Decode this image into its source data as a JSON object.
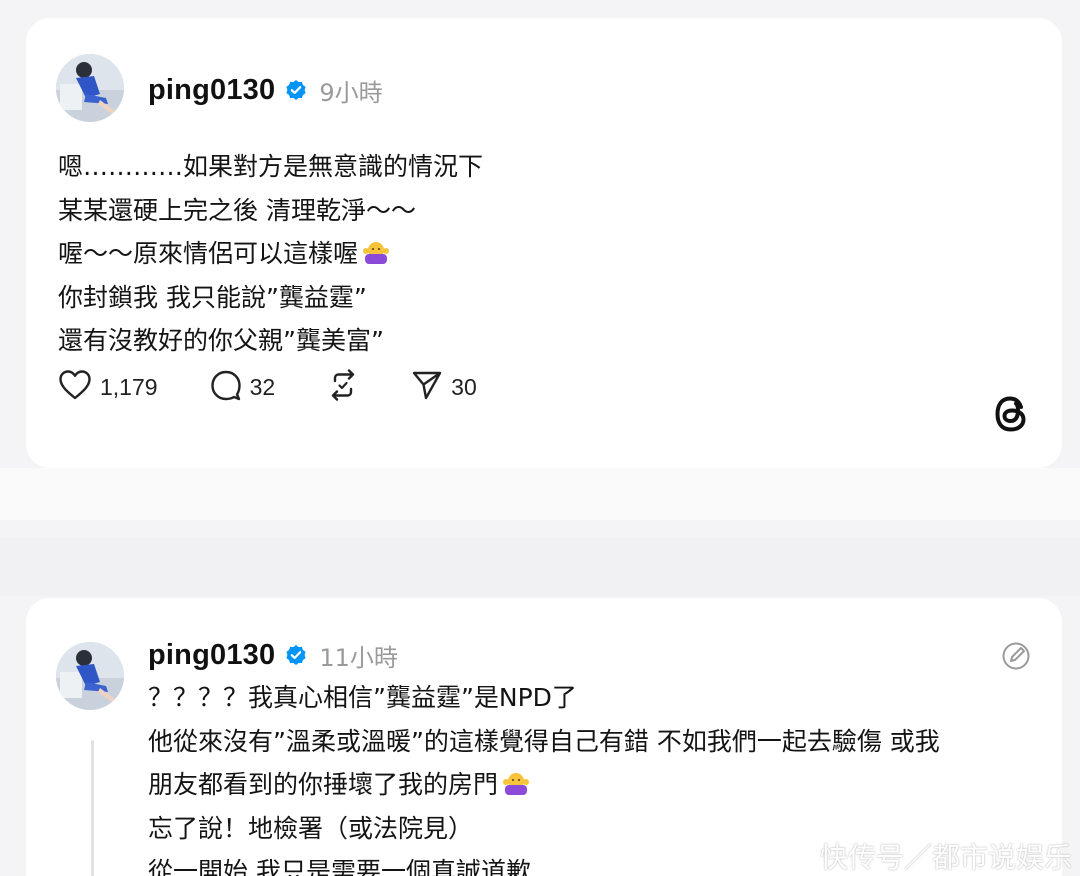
{
  "posts": [
    {
      "username": "ping0130",
      "time": "9小時",
      "lines": [
        "嗯…………如果對方是無意識的情況下",
        "某某還硬上完之後 清理乾淨～～",
        "喔～～原來情侶可以這樣喔",
        "你封鎖我 我只能說”龔益霆”",
        "還有沒教好的你父親”龔美富”"
      ],
      "likes": "1,179",
      "comments": "32",
      "shares": "30"
    },
    {
      "username": "ping0130",
      "time": "11小時",
      "lines": [
        "？？？？我真心相信”龔益霆”是NPD了",
        "他從來沒有”溫柔或溫暖”的這樣覺得自己有錯 不如我們一起去驗傷 或我",
        "朋友都看到的你捶壞了我的房門",
        "忘了說！地檢署（或法院見）",
        "從一開始 我只是需要一個真誠道歉……"
      ]
    }
  ],
  "icons": {
    "verified": "verified-badge-icon",
    "like": "heart-icon",
    "comment": "comment-icon",
    "repost": "repost-icon",
    "share": "send-icon",
    "brand": "threads-logo-icon",
    "edited": "edit-pencil-icon",
    "emoji": "shrug-emoji-icon"
  },
  "colors": {
    "verified": "#0095f6",
    "timestamp": "#9a9a9a",
    "background": "#f4f4f6"
  },
  "watermark": "快传号／都市说娱乐"
}
